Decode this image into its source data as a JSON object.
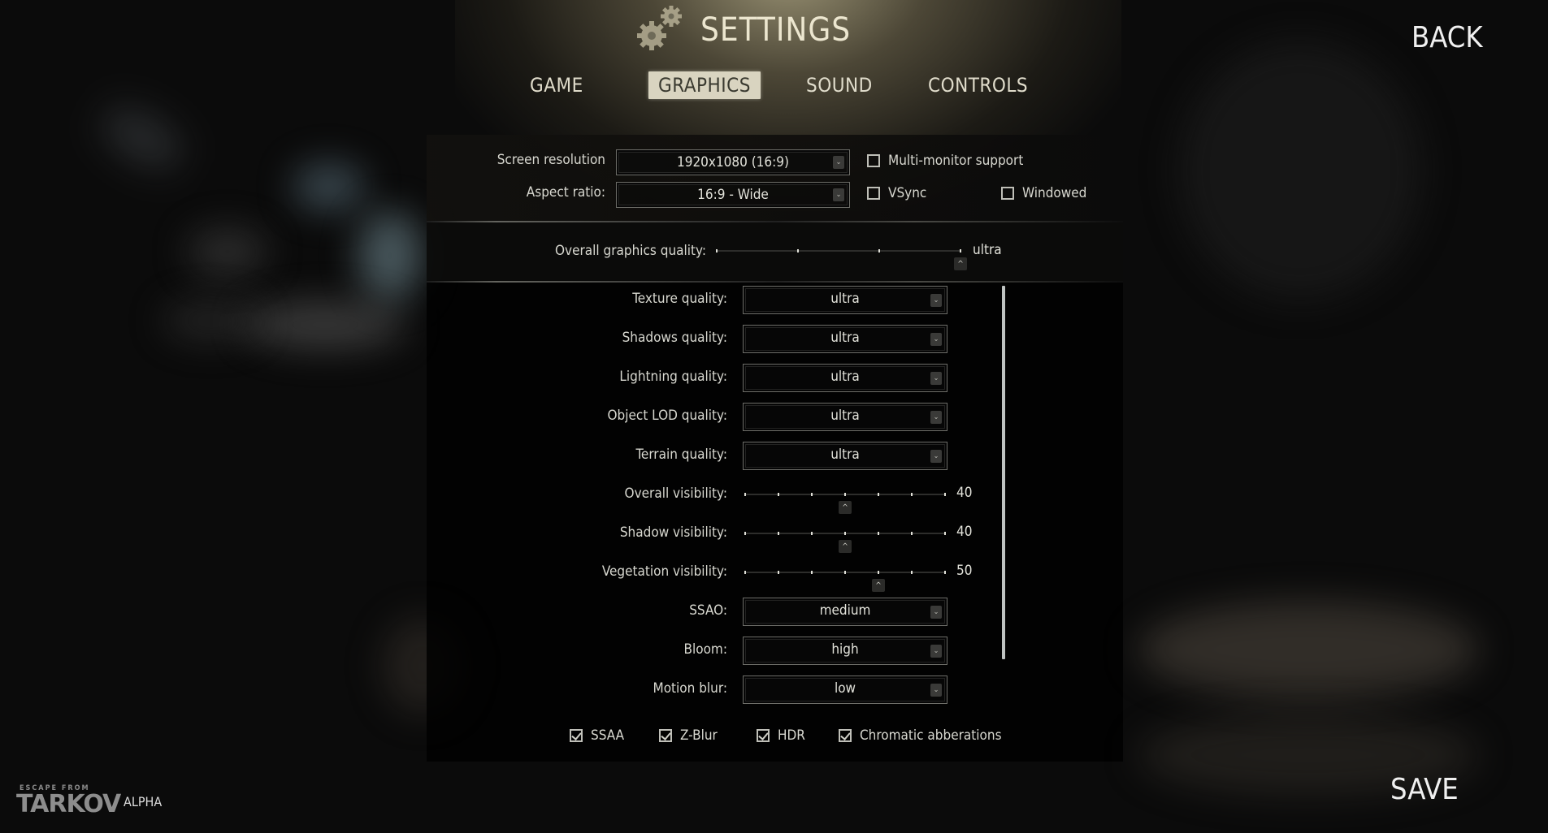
{
  "header": {
    "title": "SETTINGS",
    "icon": "gears-icon"
  },
  "tabs": [
    {
      "label": "GAME",
      "active": false
    },
    {
      "label": "GRAPHICS",
      "active": true
    },
    {
      "label": "SOUND",
      "active": false
    },
    {
      "label": "CONTROLS",
      "active": false
    }
  ],
  "nav": {
    "back_label": "BACK",
    "save_label": "SAVE"
  },
  "branding": {
    "logo_top": "ESCAPE FROM",
    "logo_main": "TARKOV",
    "badge": "ALPHA"
  },
  "display": {
    "resolution": {
      "label": "Screen resolution",
      "value": "1920x1080 (16:9)"
    },
    "aspect": {
      "label": "Aspect ratio:",
      "value": "16:9 - Wide"
    },
    "multi_monitor": {
      "label": "Multi-monitor support",
      "checked": false
    },
    "vsync": {
      "label": "VSync",
      "checked": false
    },
    "windowed": {
      "label": "Windowed",
      "checked": false
    }
  },
  "overall_quality": {
    "label": "Overall graphics quality:",
    "value": "ultra",
    "steps": 4,
    "position": 1.0
  },
  "settings": [
    {
      "type": "dropdown",
      "label": "Texture quality:",
      "value": "ultra"
    },
    {
      "type": "dropdown",
      "label": "Shadows quality:",
      "value": "ultra"
    },
    {
      "type": "dropdown",
      "label": "Lightning quality:",
      "value": "ultra"
    },
    {
      "type": "dropdown",
      "label": "Object LOD quality:",
      "value": "ultra"
    },
    {
      "type": "dropdown",
      "label": "Terrain quality:",
      "value": "ultra"
    },
    {
      "type": "slider",
      "label": "Overall visibility:",
      "value": "40",
      "steps": 7,
      "position": 0.5
    },
    {
      "type": "slider",
      "label": "Shadow visibility:",
      "value": "40",
      "steps": 7,
      "position": 0.5
    },
    {
      "type": "slider",
      "label": "Vegetation visibility:",
      "value": "50",
      "steps": 7,
      "position": 0.6667
    },
    {
      "type": "dropdown",
      "label": "SSAO:",
      "value": "medium"
    },
    {
      "type": "dropdown",
      "label": "Bloom:",
      "value": "high"
    },
    {
      "type": "dropdown",
      "label": "Motion blur:",
      "value": "low"
    }
  ],
  "effects": [
    {
      "label": "SSAA",
      "checked": true
    },
    {
      "label": "Z-Blur",
      "checked": true
    },
    {
      "label": "HDR",
      "checked": true
    },
    {
      "label": "Chromatic abberations",
      "checked": true
    }
  ],
  "icons": {
    "dropdown_arrow": "⌄",
    "slider_thumb": "^"
  }
}
